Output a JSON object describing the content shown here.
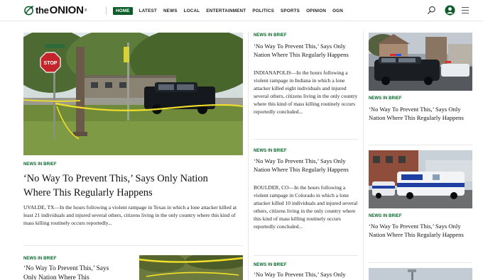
{
  "brand": {
    "the": "the",
    "onion": "ONION",
    "reg": "®"
  },
  "nav": {
    "items": [
      "HOME",
      "LATEST",
      "NEWS",
      "LOCAL",
      "ENTERTAINMENT",
      "POLITICS",
      "SPORTS",
      "OPINION",
      "OGN"
    ],
    "active": "HOME"
  },
  "icons": {
    "search": "search-icon",
    "account": "account-icon",
    "menu": "hamburger-menu-icon",
    "logo": "onion-logo-icon"
  },
  "colors": {
    "accent_green": "#0d5c2a",
    "text": "#111111"
  },
  "lead": {
    "kicker": "NEWS IN BRIEF",
    "headline": "‘No Way To Prevent This,’ Says Only Nation Where This Regularly Happens",
    "excerpt": "UVALDE, TX—In the hours following a violent rampage in Texas in which a lone attacker killed at least 21 individuals and injured several others, citizens living in the only country where this kind of mass killing routinely occurs reportedly..."
  },
  "lower_left": {
    "kicker": "NEWS IN BRIEF",
    "headline_line1": "‘No Way To Prevent This,’ Says",
    "headline_line2": "Only Nation Where This"
  },
  "middle": [
    {
      "kicker": "NEWS IN BRIEF",
      "headline": "‘No Way To Prevent This,’ Says Only Nation Where This Regularly Happens",
      "excerpt": "INDIANAPOLIS—In the hours following a violent rampage in Indiana in which a lone attacker killed eight individuals and injured several others, citizens living in the only country where this kind of mass killing routinely occurs reportedly concluded..."
    },
    {
      "kicker": "NEWS IN BRIEF",
      "headline": "‘No Way To Prevent This,’ Says Only Nation Where This Regularly Happens",
      "excerpt": "BOULDER, CO—In the hours following a violent rampage in Colorado in which a lone attacker killed 10 individuals and injured several others, citizens living in the only country where this kind of mass killing routinely occurs reportedly concluded..."
    },
    {
      "kicker": "NEWS IN BRIEF",
      "headline": "‘No Way To Prevent This,’ Says Only"
    }
  ],
  "right": [
    {
      "kicker": "NEWS IN BRIEF",
      "headline": "‘No Way To Prevent This,’ Says Only Nation Where This Regularly Happens"
    },
    {
      "kicker": "NEWS IN BRIEF",
      "headline": "‘No Way To Prevent This,’ Says Only Nation Where This Regularly Happens"
    }
  ]
}
